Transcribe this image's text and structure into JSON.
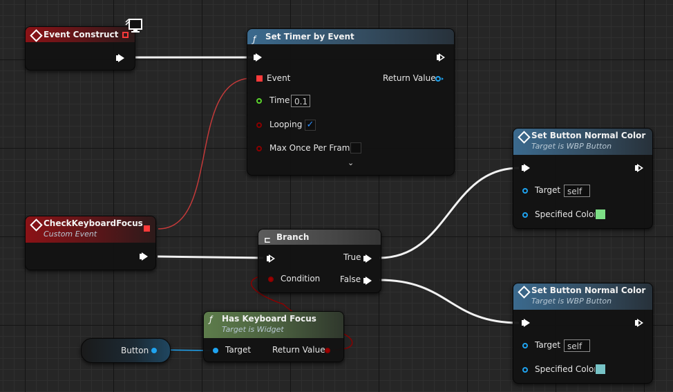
{
  "nodes": {
    "event_construct": {
      "title": "Event Construct"
    },
    "set_timer": {
      "title": "Set Timer by Event",
      "event_label": "Event",
      "return_label": "Return Value",
      "time_label": "Time",
      "time_value": "0.1",
      "looping_label": "Looping",
      "looping_checked": true,
      "looping_mark": "✓",
      "max_once_label": "Max Once Per Frame",
      "max_once_checked": false
    },
    "check_focus": {
      "title": "CheckKeyboardFocus",
      "subtitle": "Custom Event"
    },
    "branch": {
      "title": "Branch",
      "true_label": "True",
      "false_label": "False",
      "condition_label": "Condition"
    },
    "has_focus": {
      "title": "Has Keyboard Focus",
      "subtitle": "Target is Widget",
      "target_label": "Target",
      "return_label": "Return Value"
    },
    "button_var": {
      "label": "Button"
    },
    "set_color_1": {
      "title": "Set Button Normal Color",
      "subtitle": "Target is WBP Button",
      "target_label": "Target",
      "target_value": "self",
      "color_label": "Specified Color",
      "color": "#7ddf86"
    },
    "set_color_2": {
      "title": "Set Button Normal Color",
      "subtitle": "Target is WBP Button",
      "target_label": "Target",
      "target_value": "self",
      "color_label": "Specified Color",
      "color": "#77c3c6"
    }
  },
  "icons": {
    "function": "ƒ",
    "expand": "⌄",
    "branch": "⊏"
  },
  "colors": {
    "event_header": "#8b1216",
    "function_header": "#3b6a8e",
    "pure_header": "#5d7c4b",
    "object_pin": "#1fa3f0",
    "float_pin": "#5bd42d",
    "bool_pin": "#8a0000",
    "delegate_pin": "#ff3a3a"
  }
}
